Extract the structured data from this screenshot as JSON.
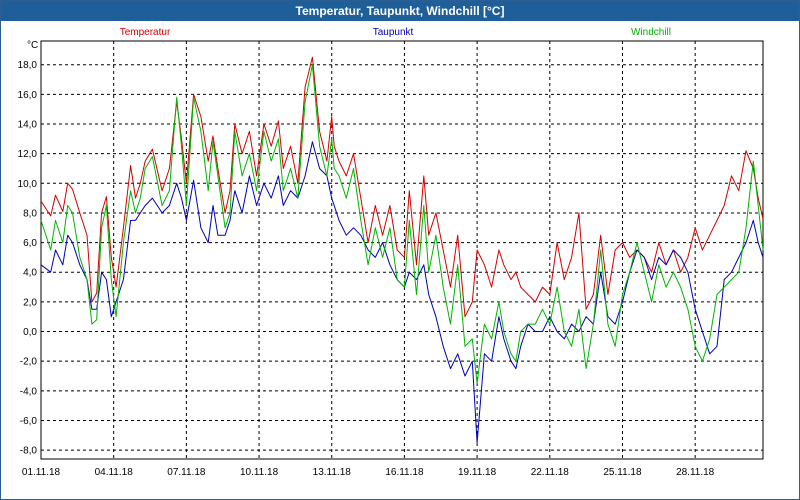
{
  "window": {
    "title": "Temperatur, Taupunkt, Windchill [°C]"
  },
  "chart_data": {
    "type": "line",
    "title": "Temperatur, Taupunkt, Windchill [°C]",
    "ylabel": "°C",
    "xlabel": "",
    "ylim": [
      -8.6,
      19.6
    ],
    "xlim": [
      0,
      29.8
    ],
    "grid": true,
    "legend_position": "top",
    "y_ticks": [
      18,
      16,
      14,
      12,
      10,
      8,
      6,
      4,
      2,
      0,
      -2,
      -4,
      -6,
      -8
    ],
    "y_tick_labels": [
      "18,0",
      "16,0",
      "14,0",
      "12,0",
      "10,0",
      "8,0",
      "6,0",
      "4,0",
      "2,0",
      "0,0",
      "-2,0",
      "-4,0",
      "-6,0",
      "-8,0"
    ],
    "x_ticks": [
      0,
      3,
      6,
      9,
      12,
      15,
      18,
      21,
      24,
      27
    ],
    "x_tick_labels": [
      "01.11.18",
      "04.11.18",
      "07.11.18",
      "10.11.18",
      "13.11.18",
      "16.11.18",
      "19.11.18",
      "22.11.18",
      "25.11.18",
      "28.11.18"
    ],
    "series": [
      {
        "name": "Temperatur",
        "color": "#d40000",
        "x": [
          0,
          0.4,
          0.6,
          0.9,
          1.1,
          1.3,
          1.6,
          1.9,
          2.1,
          2.3,
          2.5,
          2.7,
          2.9,
          3.1,
          3.4,
          3.7,
          3.9,
          4.1,
          4.3,
          4.6,
          5.0,
          5.3,
          5.6,
          5.8,
          6.0,
          6.3,
          6.6,
          6.9,
          7.1,
          7.3,
          7.6,
          7.8,
          8.0,
          8.3,
          8.6,
          8.9,
          9.2,
          9.5,
          9.8,
          10.0,
          10.3,
          10.6,
          10.9,
          11.2,
          11.5,
          11.8,
          12.0,
          12.1,
          12.3,
          12.6,
          12.9,
          13.2,
          13.5,
          13.8,
          14.1,
          14.4,
          14.7,
          15.0,
          15.2,
          15.5,
          15.8,
          16.0,
          16.3,
          16.6,
          16.9,
          17.2,
          17.5,
          17.8,
          18.0,
          18.3,
          18.6,
          18.9,
          19.1,
          19.4,
          19.6,
          19.8,
          20.1,
          20.4,
          20.7,
          21.0,
          21.3,
          21.6,
          21.9,
          22.2,
          22.5,
          22.8,
          23.1,
          23.4,
          23.7,
          24.0,
          24.3,
          24.6,
          24.9,
          25.2,
          25.5,
          25.8,
          26.1,
          26.4,
          26.7,
          27.0,
          27.3,
          27.6,
          27.9,
          28.2,
          28.5,
          28.8,
          29.1,
          29.4,
          29.6,
          29.8
        ],
        "y": [
          8.8,
          7.8,
          9.2,
          8.1,
          10.0,
          9.6,
          8.0,
          6.5,
          2.0,
          2.6,
          8.0,
          9.1,
          5.0,
          3.0,
          7.0,
          11.2,
          9.0,
          10.0,
          11.5,
          12.3,
          9.5,
          11.0,
          15.5,
          13.0,
          10.0,
          16.0,
          14.5,
          11.5,
          13.2,
          11.0,
          8.0,
          9.5,
          14.0,
          12.0,
          13.5,
          10.5,
          14.0,
          12.5,
          14.2,
          11.0,
          12.5,
          10.0,
          16.5,
          18.5,
          13.5,
          11.5,
          14.5,
          12.5,
          11.5,
          10.5,
          12.0,
          9.0,
          6.0,
          8.5,
          6.5,
          8.5,
          5.5,
          5.0,
          9.5,
          4.5,
          10.5,
          6.5,
          8.0,
          5.5,
          3.0,
          6.5,
          1.0,
          2.0,
          5.5,
          4.5,
          3.0,
          5.5,
          4.5,
          3.5,
          4.0,
          3.0,
          2.5,
          2.0,
          3.0,
          2.5,
          6.0,
          3.5,
          5.0,
          8.0,
          1.5,
          2.5,
          6.5,
          2.5,
          5.5,
          6.0,
          5.0,
          5.5,
          5.0,
          4.0,
          6.0,
          4.5,
          5.5,
          4.0,
          5.0,
          7.0,
          5.5,
          6.5,
          7.5,
          8.5,
          10.5,
          9.5,
          12.2,
          11.0,
          9.0,
          7.6
        ]
      },
      {
        "name": "Taupunkt",
        "color": "#0000b4",
        "x": [
          0,
          0.4,
          0.6,
          0.9,
          1.1,
          1.3,
          1.6,
          1.9,
          2.1,
          2.3,
          2.5,
          2.7,
          2.9,
          3.1,
          3.4,
          3.7,
          3.9,
          4.1,
          4.3,
          4.6,
          5.0,
          5.3,
          5.6,
          5.8,
          6.0,
          6.3,
          6.6,
          6.9,
          7.1,
          7.3,
          7.6,
          7.8,
          8.0,
          8.3,
          8.6,
          8.9,
          9.2,
          9.5,
          9.8,
          10.0,
          10.3,
          10.6,
          10.9,
          11.2,
          11.5,
          11.8,
          12.0,
          12.1,
          12.3,
          12.6,
          12.9,
          13.2,
          13.5,
          13.8,
          14.1,
          14.4,
          14.7,
          15.0,
          15.2,
          15.5,
          15.8,
          16.0,
          16.3,
          16.6,
          16.9,
          17.2,
          17.5,
          17.8,
          18.0,
          18.3,
          18.6,
          18.9,
          19.1,
          19.4,
          19.6,
          19.8,
          20.1,
          20.4,
          20.7,
          21.0,
          21.3,
          21.6,
          21.9,
          22.2,
          22.5,
          22.8,
          23.1,
          23.4,
          23.7,
          24.0,
          24.3,
          24.6,
          24.9,
          25.2,
          25.5,
          25.8,
          26.1,
          26.4,
          26.7,
          27.0,
          27.3,
          27.6,
          27.9,
          28.2,
          28.5,
          28.8,
          29.1,
          29.4,
          29.6,
          29.8
        ],
        "y": [
          4.5,
          4.0,
          5.5,
          4.5,
          6.5,
          6.0,
          4.5,
          3.5,
          1.5,
          1.5,
          4.0,
          3.5,
          1.0,
          2.0,
          3.5,
          7.5,
          7.5,
          8.0,
          8.5,
          9.0,
          8.0,
          8.5,
          10.0,
          9.0,
          7.5,
          10.2,
          7.0,
          6.0,
          8.5,
          6.5,
          6.5,
          7.5,
          9.5,
          8.0,
          10.5,
          8.5,
          10.0,
          9.0,
          10.5,
          8.5,
          9.5,
          9.0,
          10.5,
          12.8,
          11.0,
          10.5,
          9.0,
          8.5,
          7.5,
          6.5,
          7.0,
          6.5,
          5.5,
          5.0,
          6.0,
          4.5,
          3.5,
          3.0,
          4.0,
          3.5,
          4.5,
          2.5,
          1.0,
          -1.0,
          -2.5,
          -1.5,
          -3.0,
          -2.0,
          -7.5,
          -1.5,
          -2.0,
          1.0,
          -0.5,
          -2.0,
          -2.5,
          -1.0,
          0.5,
          0.0,
          0.0,
          1.0,
          0.0,
          -0.5,
          0.5,
          0.0,
          1.0,
          0.5,
          4.0,
          1.0,
          0.5,
          2.0,
          4.0,
          5.5,
          5.0,
          3.5,
          5.0,
          4.5,
          5.5,
          5.0,
          4.0,
          1.5,
          0.0,
          -1.5,
          -1.0,
          3.5,
          4.0,
          5.0,
          6.0,
          7.5,
          6.0,
          5.0
        ]
      },
      {
        "name": "Windchill",
        "color": "#00b400",
        "x": [
          0,
          0.4,
          0.6,
          0.9,
          1.1,
          1.3,
          1.6,
          1.9,
          2.1,
          2.3,
          2.5,
          2.7,
          2.9,
          3.1,
          3.4,
          3.7,
          3.9,
          4.1,
          4.3,
          4.6,
          5.0,
          5.3,
          5.6,
          5.8,
          6.0,
          6.3,
          6.6,
          6.9,
          7.1,
          7.3,
          7.6,
          7.8,
          8.0,
          8.3,
          8.6,
          8.9,
          9.2,
          9.5,
          9.8,
          10.0,
          10.3,
          10.6,
          10.9,
          11.2,
          11.5,
          11.8,
          12.0,
          12.1,
          12.3,
          12.6,
          12.9,
          13.2,
          13.5,
          13.8,
          14.1,
          14.4,
          14.7,
          15.0,
          15.2,
          15.5,
          15.8,
          16.0,
          16.3,
          16.6,
          16.9,
          17.2,
          17.5,
          17.8,
          18.0,
          18.3,
          18.6,
          18.9,
          19.1,
          19.4,
          19.6,
          19.8,
          20.1,
          20.4,
          20.7,
          21.0,
          21.3,
          21.6,
          21.9,
          22.2,
          22.5,
          22.8,
          23.1,
          23.4,
          23.7,
          24.0,
          24.3,
          24.6,
          24.9,
          25.2,
          25.5,
          25.8,
          26.1,
          26.4,
          26.7,
          27.0,
          27.3,
          27.6,
          27.9,
          28.2,
          28.5,
          28.8,
          29.1,
          29.4,
          29.6,
          29.8
        ],
        "y": [
          7.5,
          5.5,
          7.5,
          6.0,
          8.5,
          8.0,
          5.0,
          3.5,
          0.5,
          0.8,
          7.0,
          8.5,
          3.5,
          1.0,
          6.0,
          9.5,
          8.0,
          9.0,
          11.0,
          11.8,
          8.5,
          9.5,
          15.8,
          12.5,
          8.5,
          15.8,
          13.5,
          9.5,
          12.8,
          10.5,
          7.0,
          8.0,
          13.5,
          10.5,
          12.0,
          9.5,
          13.5,
          11.5,
          13.0,
          9.5,
          11.0,
          9.0,
          15.5,
          18.0,
          12.5,
          10.5,
          13.0,
          11.0,
          10.5,
          9.0,
          11.0,
          7.5,
          4.5,
          7.0,
          5.0,
          7.0,
          3.5,
          3.0,
          7.5,
          2.5,
          8.5,
          4.0,
          6.5,
          3.0,
          0.5,
          4.5,
          -1.0,
          -0.5,
          -3.5,
          0.5,
          -0.5,
          2.0,
          0.0,
          -1.5,
          -2.0,
          0.0,
          0.5,
          0.5,
          1.5,
          0.5,
          3.0,
          0.0,
          -1.0,
          1.5,
          -2.5,
          0.5,
          5.5,
          0.5,
          -1.0,
          2.5,
          4.0,
          6.0,
          4.0,
          2.0,
          4.5,
          3.0,
          4.0,
          3.0,
          1.5,
          -1.0,
          -2.0,
          -0.5,
          2.5,
          3.0,
          3.5,
          4.0,
          7.0,
          11.5,
          8.5,
          5.5
        ]
      }
    ]
  }
}
